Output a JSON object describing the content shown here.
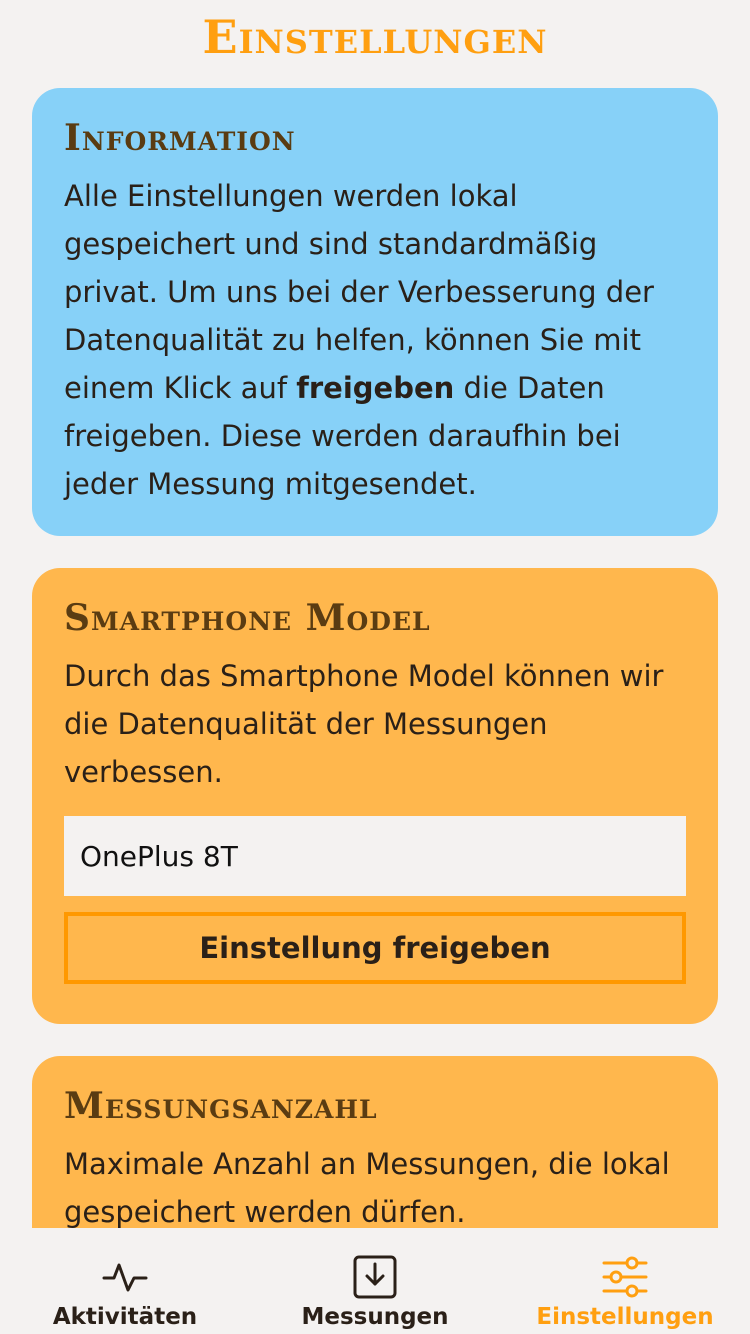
{
  "page": {
    "title": "Einstellungen"
  },
  "info_card": {
    "title": "Information",
    "text_before": "Alle Einstellungen werden lokal gespeichert und sind standardmäßig privat. Um uns bei der Verbesserung der Datenqualität zu helfen, können Sie mit einem Klick auf ",
    "text_bold": "freigeben",
    "text_after": " die Daten freigeben. Diese werden daraufhin bei jeder Messung mitgesendet."
  },
  "model_card": {
    "title": "Smartphone Model",
    "text": "Durch das Smartphone Model können wir die Datenqualität der Messungen verbessen.",
    "input_value": "OnePlus 8T",
    "button_label": "Einstellung freigeben"
  },
  "count_card": {
    "title": "Messungsanzahl",
    "text": "Maximale Anzahl an Messungen, die lokal gespeichert werden dürfen."
  },
  "bottom_nav": {
    "items": [
      {
        "label": "Aktivitäten",
        "icon": "activity-icon",
        "active": false
      },
      {
        "label": "Messungen",
        "icon": "download-box-icon",
        "active": false
      },
      {
        "label": "Einstellungen",
        "icon": "sliders-icon",
        "active": true
      }
    ]
  },
  "colors": {
    "accent": "#ff9f10",
    "info_card_bg": "#87d1f8",
    "setting_card_bg": "#ffb74d",
    "card_title": "#5a3c12",
    "background": "#f4f2f1"
  }
}
